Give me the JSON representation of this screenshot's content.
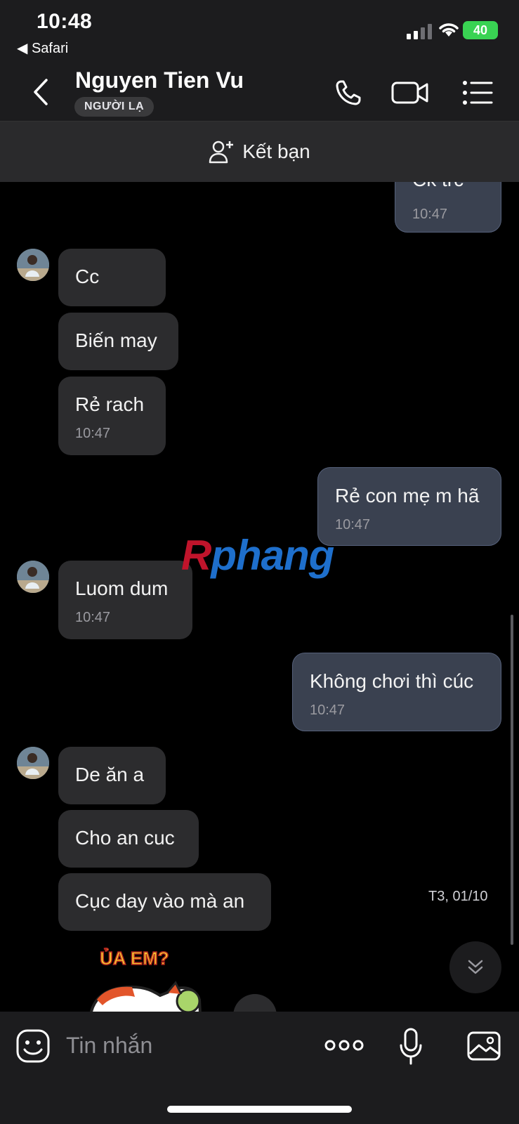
{
  "status_bar": {
    "time": "10:48",
    "back_app": "◀ Safari",
    "battery": "40"
  },
  "header": {
    "contact_name": "Nguyen Tien Vu",
    "badge": "NGƯỜI LẠ"
  },
  "add_friend": {
    "label": "Kết bạn"
  },
  "messages": [
    {
      "dir": "out",
      "text": "Ck trc",
      "time": "10:47"
    },
    {
      "dir": "in",
      "text": "Cc",
      "time": ""
    },
    {
      "dir": "in",
      "text": "Biến may",
      "time": ""
    },
    {
      "dir": "in",
      "text": "Rẻ rach",
      "time": "10:47"
    },
    {
      "dir": "out",
      "text": "Rẻ con mẹ m hã",
      "time": "10:47"
    },
    {
      "dir": "in",
      "text": "Luom dum",
      "time": "10:47"
    },
    {
      "dir": "out",
      "text": "Không chơi thì cúc",
      "time": "10:47"
    },
    {
      "dir": "in",
      "text": "De ăn a",
      "time": ""
    },
    {
      "dir": "in",
      "text": "Cho an cuc",
      "time": ""
    },
    {
      "dir": "in",
      "text": "Cục day vào mà an",
      "time": ""
    }
  ],
  "date_separator": "T3, 01/10",
  "sticker": {
    "caption": "ỦA EM?"
  },
  "watermark": {
    "first": "R",
    "rest": "phang"
  },
  "input": {
    "placeholder": "Tin nhắn"
  },
  "icons": {
    "back": "chevron-left-icon",
    "call": "phone-icon",
    "video": "video-camera-icon",
    "menu": "list-icon",
    "add_friend": "add-user-icon",
    "emoji": "emoji-icon",
    "more": "more-icon",
    "mic": "microphone-icon",
    "image": "image-icon",
    "scroll_down": "double-chevron-down-icon"
  },
  "colors": {
    "incoming_bubble": "#2c2c2e",
    "outgoing_bubble": "#3a4150",
    "battery": "#39d353"
  }
}
